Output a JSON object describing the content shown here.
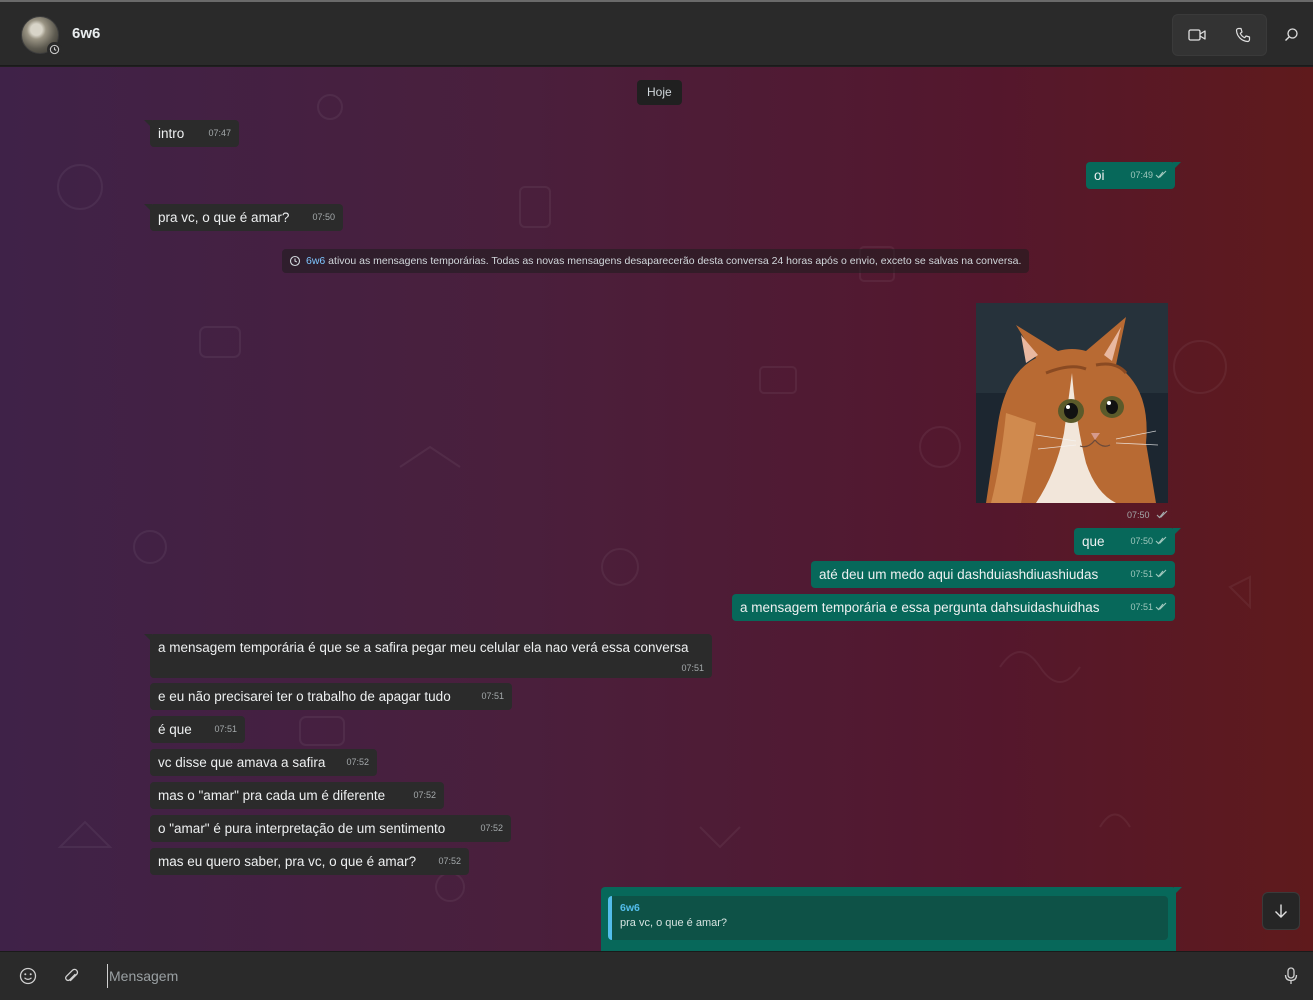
{
  "header": {
    "contact_name": "6w6"
  },
  "chat": {
    "day_label": "Hoje",
    "system_message": {
      "name": "6w6",
      "text": " ativou as mensagens temporárias. Todas as novas mensagens desaparecerão desta conversa 24 horas após o envio, exceto se salvas na conversa."
    },
    "messages": [
      {
        "dir": "in",
        "text": "intro",
        "time": "07:47"
      },
      {
        "dir": "out",
        "text": "oi",
        "time": "07:49"
      },
      {
        "dir": "in",
        "text": "pra vc, o que é amar?",
        "time": "07:50"
      },
      {
        "dir": "out",
        "text": "",
        "time": "07:50",
        "image": "cat-photo"
      },
      {
        "dir": "out",
        "text": "que",
        "time": "07:50"
      },
      {
        "dir": "out",
        "text": "até deu um medo aqui dashduiashdiuashiudas",
        "time": "07:51"
      },
      {
        "dir": "out",
        "text": "a mensagem temporária e essa pergunta dahsuidashuidhas",
        "time": "07:51"
      },
      {
        "dir": "in",
        "text": "a mensagem temporária é que se a safira pegar meu celular ela nao verá essa conversa",
        "time": "07:51"
      },
      {
        "dir": "in",
        "text": "e eu não precisarei ter o trabalho de apagar tudo",
        "time": "07:51"
      },
      {
        "dir": "in",
        "text": "é que",
        "time": "07:51"
      },
      {
        "dir": "in",
        "text": "vc disse que amava a safira",
        "time": "07:52"
      },
      {
        "dir": "in",
        "text": "mas o \"amar\" pra cada um é diferente",
        "time": "07:52"
      },
      {
        "dir": "in",
        "text": "o \"amar\" é pura interpretação de um sentimento",
        "time": "07:52"
      },
      {
        "dir": "in",
        "text": "mas eu quero saber, pra vc, o que é amar?",
        "time": "07:52"
      }
    ],
    "reply_quote": {
      "name": "6w6",
      "text": "pra vc, o que é amar?"
    }
  },
  "composer": {
    "placeholder": "Mensagem"
  },
  "icons": [
    "emoji-icon",
    "attach-icon",
    "mic-icon",
    "video-call-icon",
    "voice-call-icon",
    "search-icon",
    "arrow-down-icon",
    "read-receipt-icon",
    "timer-icon"
  ],
  "colors": {
    "outgoing_bubble": "#07685a",
    "incoming_bubble": "#2b2b2b",
    "link_blue": "#53bdeb"
  }
}
